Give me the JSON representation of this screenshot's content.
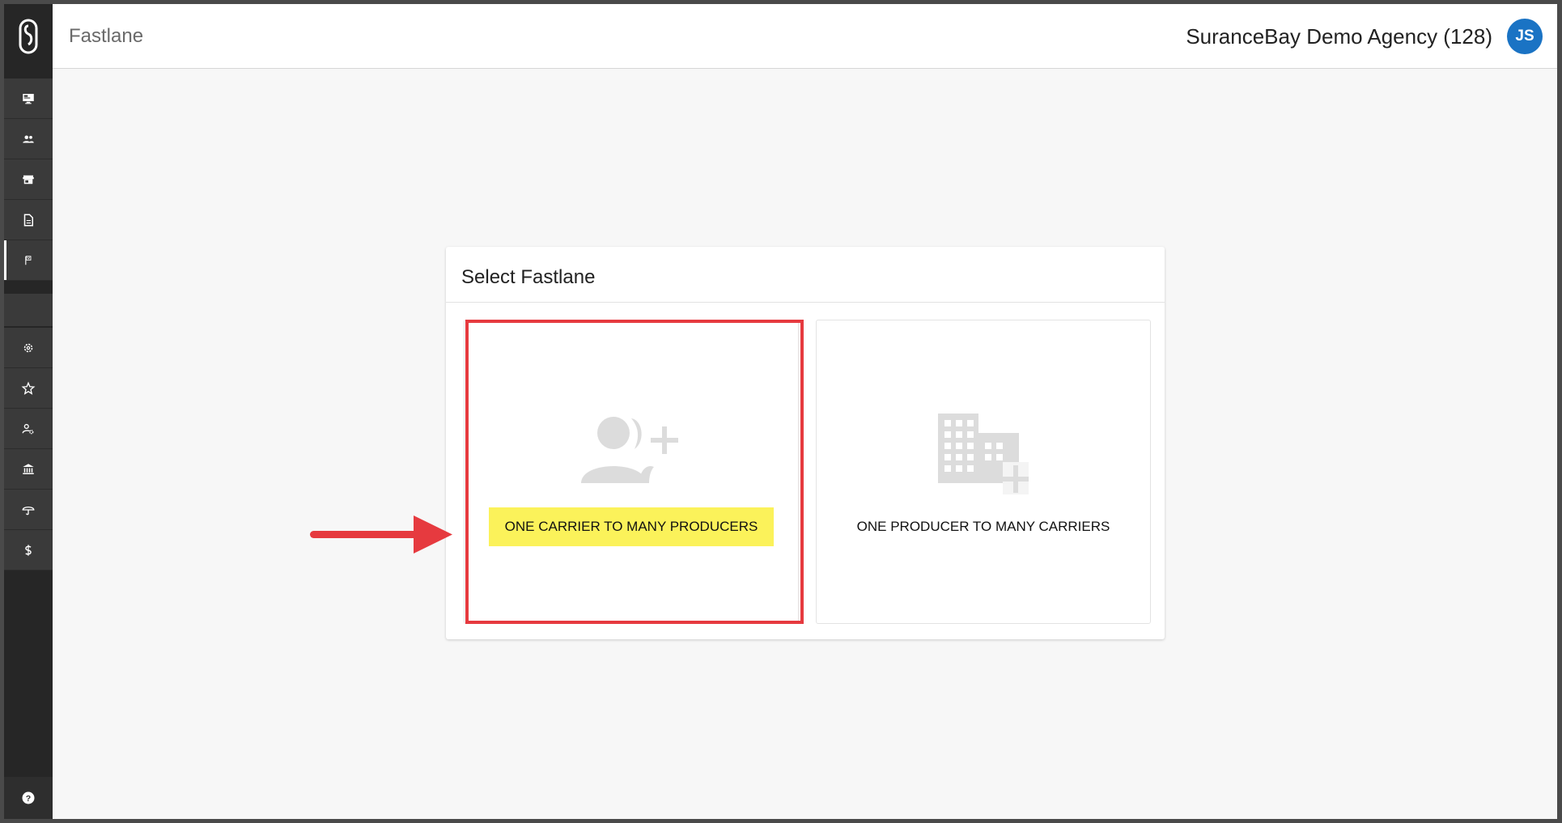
{
  "header": {
    "app_title": "Fastlane",
    "agency": "SuranceBay Demo Agency (128)",
    "avatar_initials": "JS"
  },
  "sidebar": {
    "items_top": [
      {
        "name": "dashboard-icon"
      },
      {
        "name": "people-icon"
      },
      {
        "name": "store-icon"
      },
      {
        "name": "document-icon"
      },
      {
        "name": "flag-icon",
        "active": true
      }
    ],
    "items_bottom": [
      {
        "name": "gear-icon"
      },
      {
        "name": "star-icon"
      },
      {
        "name": "user-settings-icon"
      },
      {
        "name": "bank-icon"
      },
      {
        "name": "umbrella-icon"
      },
      {
        "name": "dollar-icon"
      }
    ],
    "help_icon": "help-icon"
  },
  "card": {
    "title": "Select Fastlane",
    "options": [
      {
        "label": "ONE CARRIER TO MANY PRODUCERS",
        "icon": "add-people-icon",
        "highlighted": true
      },
      {
        "label": "ONE PRODUCER TO MANY CARRIERS",
        "icon": "add-building-icon",
        "highlighted": false
      }
    ]
  },
  "colors": {
    "sidebar_bg": "#262626",
    "avatar": "#1a73c4",
    "highlight": "#fbf25a",
    "annotation_red": "#e63a3f"
  }
}
